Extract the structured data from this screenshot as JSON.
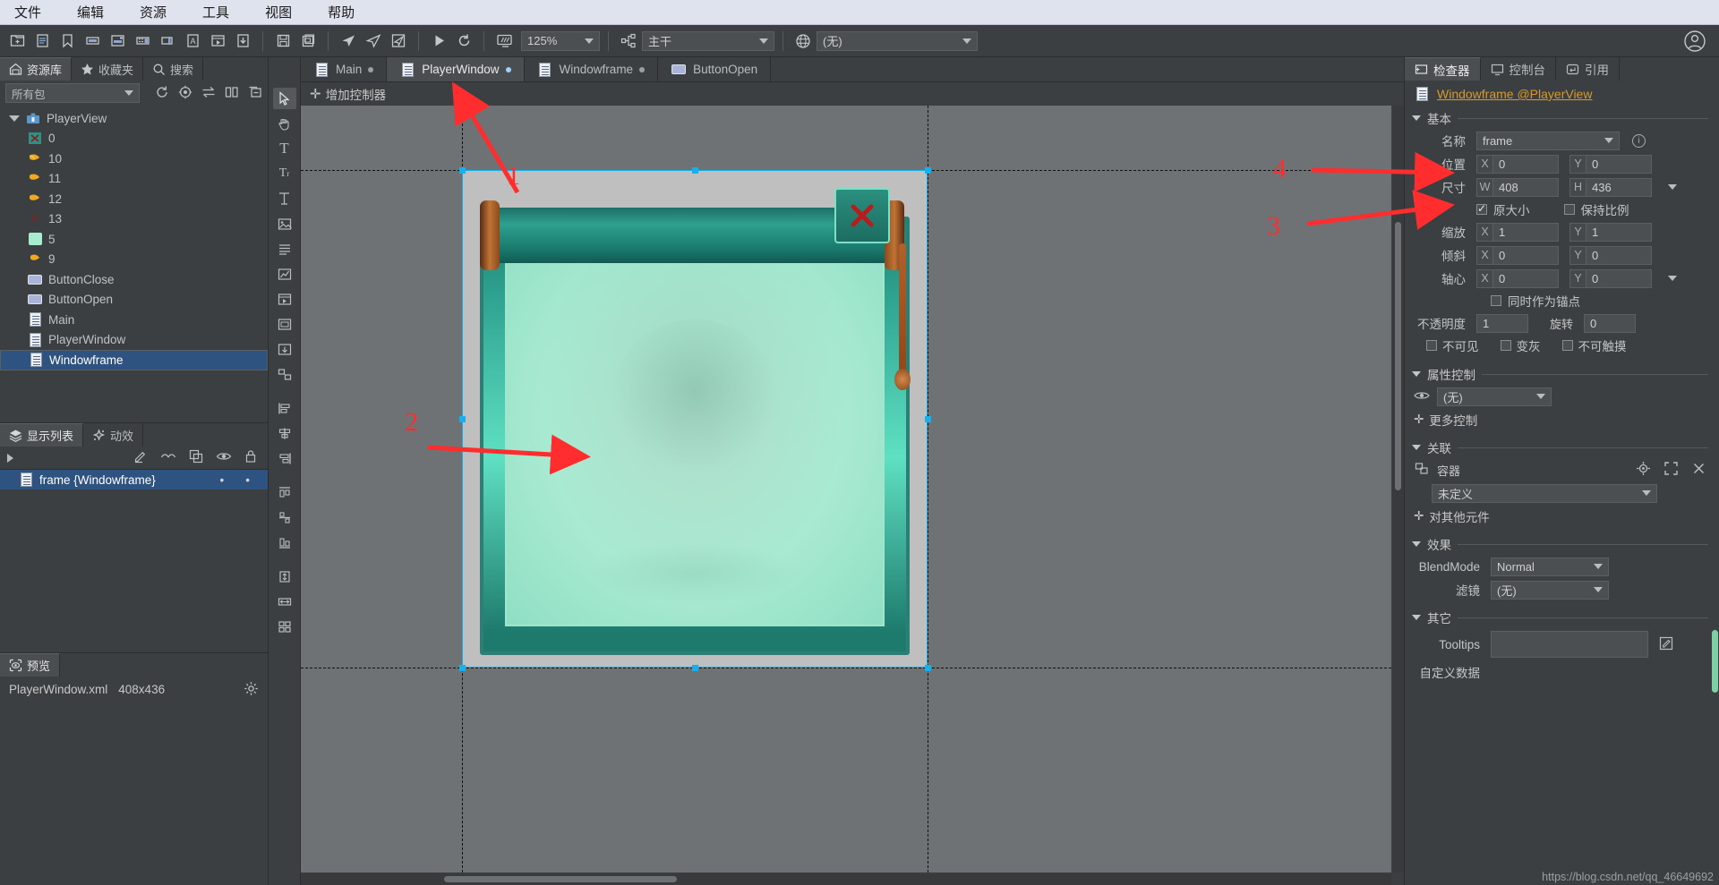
{
  "menubar": {
    "items": [
      "文件",
      "编辑",
      "资源",
      "工具",
      "视图",
      "帮助"
    ]
  },
  "toolbar": {
    "icons": [
      "new-folder-icon",
      "new-document-icon",
      "bookmark-icon",
      "new-component-icon",
      "new-window-icon",
      "new-film-icon",
      "new-slider-icon",
      "new-text-icon",
      "new-movieclip-icon",
      "import-icon",
      "save-icon",
      "save-all-icon",
      "publish-icon",
      "publish-all-icon",
      "publish-settings-icon",
      "preview-play-icon",
      "refresh-icon",
      "device-icon"
    ],
    "zoom_value": "125%",
    "branch_icon": "branch-icon",
    "branch_value": "主干",
    "globe_icon": "globe-icon",
    "language_value": "(无)",
    "account_icon": "account-icon"
  },
  "left_panel": {
    "tabs": [
      {
        "label": "资源库",
        "icon": "library-icon",
        "active": true
      },
      {
        "label": "收藏夹",
        "icon": "star-icon",
        "active": false
      },
      {
        "label": "搜索",
        "icon": "search-icon",
        "active": false
      }
    ],
    "package_filter": "所有包",
    "filter_icons": [
      "refresh-icon",
      "locate-icon",
      "sort-icon",
      "split-view-icon",
      "collapse-icon"
    ],
    "tree": [
      {
        "label": "PlayerView",
        "icon": "package-icon",
        "depth": 0,
        "expanded": true,
        "selected": false
      },
      {
        "label": "0",
        "icon": "image-icon",
        "depth": 1,
        "selected": false
      },
      {
        "label": "10",
        "icon": "image-moon-icon",
        "depth": 1,
        "selected": false
      },
      {
        "label": "11",
        "icon": "image-moon-icon",
        "depth": 1,
        "selected": false
      },
      {
        "label": "12",
        "icon": "image-moon-icon",
        "depth": 1,
        "selected": false
      },
      {
        "label": "13",
        "icon": "image-dark-icon",
        "depth": 1,
        "selected": false
      },
      {
        "label": "5",
        "icon": "image-green-icon",
        "depth": 1,
        "selected": false
      },
      {
        "label": "9",
        "icon": "image-moon-icon",
        "depth": 1,
        "selected": false
      },
      {
        "label": "ButtonClose",
        "icon": "button-icon",
        "depth": 1,
        "selected": false
      },
      {
        "label": "ButtonOpen",
        "icon": "button-icon",
        "depth": 1,
        "selected": false
      },
      {
        "label": "Main",
        "icon": "component-icon",
        "depth": 1,
        "selected": false
      },
      {
        "label": "PlayerWindow",
        "icon": "component-icon",
        "depth": 1,
        "selected": false
      },
      {
        "label": "Windowframe",
        "icon": "component-icon",
        "depth": 1,
        "selected": true
      }
    ]
  },
  "display_list": {
    "tabs": [
      {
        "label": "显示列表",
        "icon": "layers-icon",
        "active": true
      },
      {
        "label": "动效",
        "icon": "effect-icon",
        "active": false
      }
    ],
    "header_icons": [
      "edit-icon",
      "link-icon",
      "duplicate-icon",
      "visible-icon",
      "lock-icon"
    ],
    "rows": [
      {
        "label": "frame {Windowframe}",
        "icon": "component-icon",
        "selected": true,
        "visible_dot": "•",
        "lock_dot": "•"
      }
    ]
  },
  "preview": {
    "tab_label": "预览",
    "tab_icon": "preview-icon",
    "file_name": "PlayerWindow.xml",
    "file_size": "408x436",
    "gear_icon": "gear-icon"
  },
  "toolstrip": {
    "tools": [
      "cursor-icon",
      "hand-icon",
      "text-icon",
      "rich-text-icon",
      "input-text-icon",
      "image-icon",
      "list-icon",
      "graph-icon",
      "movieclip-icon",
      "component-icon",
      "loader-icon",
      "group-icon",
      "align-left-icon",
      "align-center-icon",
      "align-right-icon",
      "distribute-h-icon",
      "distribute-v-icon",
      "distribute-d-icon",
      "stretch-v-icon",
      "stretch-h-icon",
      "grid-icon"
    ]
  },
  "document_tabs": [
    {
      "label": "Main",
      "icon": "component-icon",
      "modified": true,
      "active": false
    },
    {
      "label": "PlayerWindow",
      "icon": "component-icon",
      "modified": true,
      "active": true
    },
    {
      "label": "Windowframe",
      "icon": "component-icon",
      "modified": true,
      "active": false
    },
    {
      "label": "ButtonOpen",
      "icon": "button-icon",
      "modified": false,
      "active": false
    }
  ],
  "canvas": {
    "add_controller_label": "增加控制器",
    "add_controller_icon": "plus-icon"
  },
  "inspector": {
    "tabs": [
      {
        "label": "检查器",
        "icon": "inspector-icon",
        "active": true
      },
      {
        "label": "控制台",
        "icon": "console-icon",
        "active": false
      },
      {
        "label": "引用",
        "icon": "reference-icon",
        "active": false
      }
    ],
    "title": "Windowframe @PlayerView",
    "title_icon": "component-icon",
    "sections": {
      "basic": {
        "label": "基本",
        "name_label": "名称",
        "name_value": "frame",
        "info_icon": "info-icon",
        "position_label": "位置",
        "position_x": "0",
        "position_y": "0",
        "size_label": "尺寸",
        "size_w": "408",
        "size_h": "436",
        "original_size_label": "原大小",
        "original_size_checked": true,
        "keep_ratio_label": "保持比例",
        "keep_ratio_checked": false,
        "scale_label": "缩放",
        "scale_x": "1",
        "scale_y": "1",
        "skew_label": "倾斜",
        "skew_x": "0",
        "skew_y": "0",
        "pivot_label": "轴心",
        "pivot_x": "0",
        "pivot_y": "0",
        "pivot_as_anchor_label": "同时作为锚点",
        "pivot_as_anchor_checked": false,
        "alpha_label": "不透明度",
        "alpha_value": "1",
        "rotation_label": "旋转",
        "rotation_value": "0",
        "invisible_label": "不可见",
        "invisible_checked": false,
        "grayed_label": "变灰",
        "grayed_checked": false,
        "untouchable_label": "不可触摸",
        "untouchable_checked": false
      },
      "property_control": {
        "label": "属性控制",
        "eye_icon": "eye-icon",
        "value": "(无)",
        "more_label": "更多控制",
        "more_icon": "plus-icon"
      },
      "relation": {
        "label": "关联",
        "container_label": "容器",
        "container_icon": "relation-icon",
        "container_value": "未定义",
        "action_icons": [
          "target-icon",
          "expand-icon",
          "close-icon"
        ],
        "other_label": "对其他元件",
        "other_icon": "plus-icon"
      },
      "effect": {
        "label": "效果",
        "blendmode_label": "BlendMode",
        "blendmode_value": "Normal",
        "filter_label": "滤镜",
        "filter_value": "(无)"
      },
      "other": {
        "label": "其它",
        "tooltips_label": "Tooltips",
        "tooltips_value": "",
        "tooltips_edit_icon": "edit-icon",
        "custom_data_label": "自定义数据"
      }
    }
  },
  "annotations": [
    {
      "number": "1"
    },
    {
      "number": "2"
    },
    {
      "number": "3"
    },
    {
      "number": "4"
    }
  ],
  "watermark": "https://blog.csdn.net/qq_46649692",
  "colors": {
    "accent_blue": "#2f5380",
    "handle_blue": "#17b0ef",
    "link_orange": "#d79a2b",
    "annotation_red": "#ff2d2d",
    "panel_bg": "#3c3f41",
    "stage_bg": "#6f7275"
  }
}
